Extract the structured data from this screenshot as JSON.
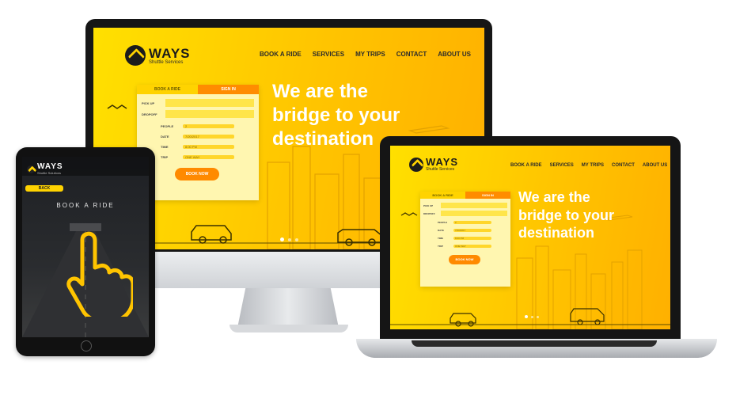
{
  "brand": {
    "name": "WAYS",
    "tagline": "Shuttle Services",
    "tagline_mobile": "Shuttle Solutions"
  },
  "nav": [
    "BOOK A RIDE",
    "SERVICES",
    "MY TRIPS",
    "CONTACT",
    "ABOUT US"
  ],
  "hero": {
    "line1": "We are the",
    "line2": "bridge to your",
    "line3": "destination"
  },
  "booking_form": {
    "tab_book": "BOOK A RIDE",
    "tab_signin": "SIGN IN",
    "pickup_label": "PICK UP",
    "dropoff_label": "DROPOFF",
    "people_label": "PEOPLE",
    "people_value": "2",
    "date_label": "DATE",
    "date_value": "7/20/2017",
    "time_label": "TIME",
    "time_value": "8:00 PM",
    "trip_label": "TRIP",
    "trip_value": "ONE WAY",
    "submit": "BOOK NOW"
  },
  "mobile": {
    "back": "BACK",
    "title": "BOOK A RIDE"
  },
  "colors": {
    "yellow": "#ffd000",
    "orange": "#ff8a00",
    "device_dark": "#1c1c1c",
    "silver": "#c9ccd0"
  }
}
